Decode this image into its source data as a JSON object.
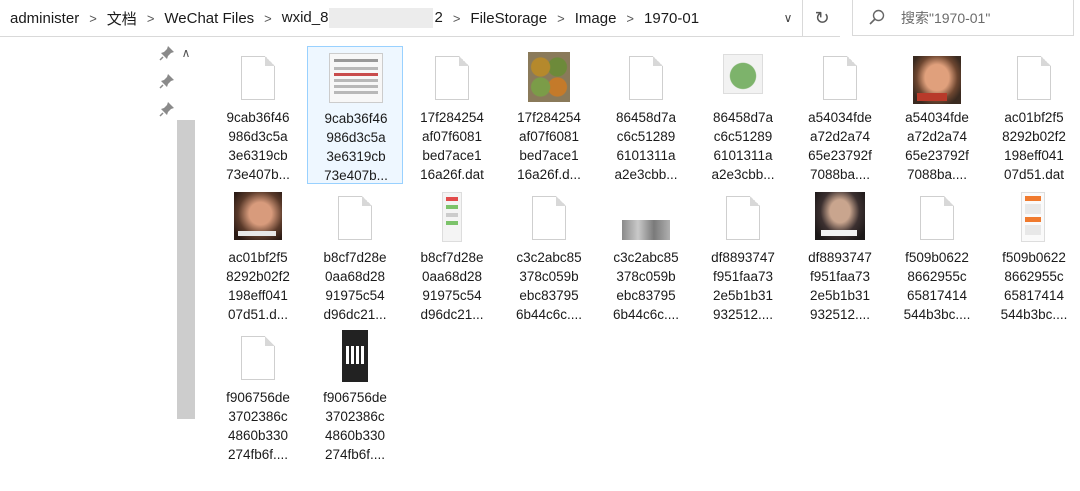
{
  "address_bar": {
    "crumbs": [
      "administer",
      "文档",
      "WeChat Files",
      "wxid_8",
      "2",
      "FileStorage",
      "Image",
      "1970-01"
    ],
    "dropdown_icon": "chevron-down-icon",
    "refresh_icon": "refresh-icon"
  },
  "search": {
    "placeholder": "搜索\"1970-01\"",
    "icon": "search-icon"
  },
  "quick_access": {
    "pin_icon": "pin-icon",
    "scroll_up_icon": "chevron-up-icon"
  },
  "files": [
    {
      "name": "9cab36f46\n986d3c5a\n3e6319cb\n73e407b...",
      "thumb": "doc"
    },
    {
      "name": "9cab36f46\n986d3c5a\n3e6319cb\n73e407b...",
      "thumb": "screenshot",
      "selected": true
    },
    {
      "name": "17f284254\naf07f6081\nbed7ace1\n16a26f.dat",
      "thumb": "doc"
    },
    {
      "name": "17f284254\naf07f6081\nbed7ace1\n16a26f.d...",
      "thumb": "food"
    },
    {
      "name": "86458d7a\nc6c51289\n6101311a\na2e3cbb...",
      "thumb": "doc"
    },
    {
      "name": "86458d7a\nc6c51289\n6101311a\na2e3cbb...",
      "thumb": "meme"
    },
    {
      "name": "a54034fde\na72d2a74\n65e23792f\n7088ba....",
      "thumb": "doc"
    },
    {
      "name": "a54034fde\na72d2a74\n65e23792f\n7088ba....",
      "thumb": "face-red"
    },
    {
      "name": "ac01bf2f5\n8292b02f2\n198eff041\n07d51.dat",
      "thumb": "doc"
    },
    {
      "name": "ac01bf2f5\n8292b02f2\n198eff041\n07d51.d...",
      "thumb": "face-dark"
    },
    {
      "name": "b8cf7d28e\n0aa68d28\n91975c54\nd96dc21...",
      "thumb": "doc"
    },
    {
      "name": "b8cf7d28e\n0aa68d28\n91975c54\nd96dc21...",
      "thumb": "chat"
    },
    {
      "name": "c3c2abc85\n378c059b\nebc83795\n6b44c6c....",
      "thumb": "doc"
    },
    {
      "name": "c3c2abc85\n378c059b\nebc83795\n6b44c6c....",
      "thumb": "strip"
    },
    {
      "name": "df8893747\nf951faa73\n2e5b1b31\n932512....",
      "thumb": "doc"
    },
    {
      "name": "df8893747\nf951faa73\n2e5b1b31\n932512....",
      "thumb": "face-gray"
    },
    {
      "name": "f509b0622\n8662955c\n65817414\n544b3bc....",
      "thumb": "doc"
    },
    {
      "name": "f509b0622\n8662955c\n65817414\n544b3bc....",
      "thumb": "phone"
    },
    {
      "name": "f906756de\n3702386c\n4860b330\n274fb6f....",
      "thumb": "doc"
    },
    {
      "name": "f906756de\n3702386c\n4860b330\n274fb6f....",
      "thumb": "qr"
    }
  ]
}
